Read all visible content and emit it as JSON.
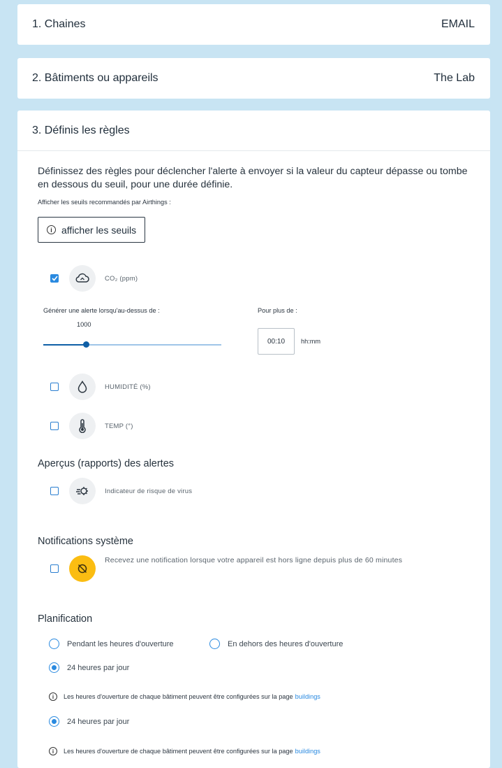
{
  "steps": [
    {
      "title": "1. Chaines",
      "value": "EMAIL"
    },
    {
      "title": "2. Bâtiments ou appareils",
      "value": "The Lab"
    },
    {
      "title": "3. Définis les règles"
    }
  ],
  "rules": {
    "intro": "Définissez des règles pour déclencher l'alerte à envoyer si la valeur du capteur dépasse ou tombe en dessous du seuil, pour une durée définie.",
    "recommended_label": "Afficher les seuils recommandés par Airthings :",
    "show_thresholds_button": "afficher les seuils",
    "sensors": [
      {
        "label": "CO₂ (ppm)",
        "checked": true,
        "icon": "co2-cloud-icon"
      },
      {
        "label": "HUMIDITÉ (%)",
        "checked": false,
        "icon": "humidity-drop-icon"
      },
      {
        "label": "TEMP (°)",
        "checked": false,
        "icon": "thermometer-icon"
      }
    ],
    "co2": {
      "alert_above_label": "Générer une alerte lorsqu'au-dessus de :",
      "threshold_value": "1000",
      "slider_fraction": 0.24,
      "duration_label": "Pour plus de :",
      "duration_value": "00:10",
      "duration_unit": "hh:mm"
    }
  },
  "insights": {
    "title": "Aperçus (rapports) des alertes",
    "items": [
      {
        "label": "Indicateur de risque de virus",
        "checked": false,
        "icon": "virus-icon"
      }
    ]
  },
  "system": {
    "title": "Notifications système",
    "items": [
      {
        "label": "Recevez une notification lorsque votre appareil est hors ligne depuis plus de 60 minutes",
        "checked": false,
        "icon": "offline-icon"
      }
    ]
  },
  "schedule": {
    "title": "Planification",
    "options": [
      {
        "label": "Pendant les heures d'ouverture",
        "selected": false
      },
      {
        "label": "En dehors des heures d'ouverture",
        "selected": false
      },
      {
        "label": "24 heures par jour",
        "selected": true
      }
    ],
    "info_text": "Les heures d'ouverture de chaque bâtiment peuvent être configurées sur la page",
    "info_link": "buildings",
    "repeat_option": "24 heures par jour"
  },
  "colors": {
    "accent": "#2a8ae0",
    "warning": "#fbbd12",
    "background": "#c8e4f3",
    "slider": "#0f5fa6"
  }
}
